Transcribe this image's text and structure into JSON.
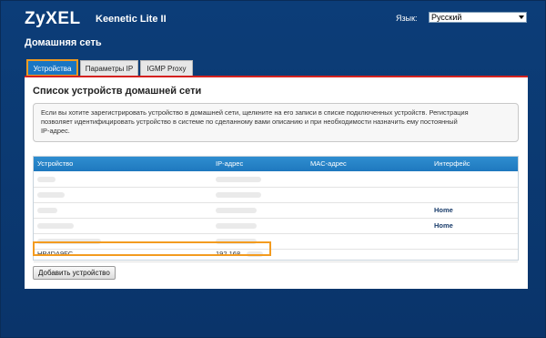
{
  "header": {
    "logo": "ZyXEL",
    "model": "Keenetic Lite II",
    "language_label": "Язык:",
    "language_value": "Русский"
  },
  "page_title": "Домашняя сеть",
  "tabs": [
    {
      "label": "Устройства",
      "active": true
    },
    {
      "label": "Параметры IP",
      "active": false
    },
    {
      "label": "IGMP Proxy",
      "active": false
    }
  ],
  "panel": {
    "title": "Список устройств домашней сети",
    "info_lines": [
      "Если вы хотите зарегистрировать устройство в домашней сети, щелкните на его записи в списке подключенных устройств. Регистрация",
      "позволяет идентифицировать устройство в системе по сделанному вами описанию и при необходимости назначить ему постоянный",
      "IP-адрес."
    ]
  },
  "table": {
    "columns": [
      "Устройство",
      "IP-адрес",
      "MAC-адрес",
      "Интерфейс"
    ],
    "rows": [
      {
        "device": "",
        "ip": "",
        "mac": "",
        "iface": ""
      },
      {
        "device": "",
        "ip": "",
        "mac": "",
        "iface": ""
      },
      {
        "device": "",
        "ip": "",
        "mac": "",
        "iface": "Home"
      },
      {
        "device": "",
        "ip": "",
        "mac": "",
        "iface": "Home"
      },
      {
        "device": "",
        "ip": "",
        "mac": "",
        "iface": ""
      },
      {
        "device": "HP4DA9FC",
        "ip": "192.168.",
        "mac": "",
        "iface": ""
      }
    ]
  },
  "add_button": "Добавить устройство",
  "colors": {
    "background": "#0b3a73",
    "tab_active": "#1a76c3",
    "highlight": "#f39b1f",
    "panel_top": "#d3211f",
    "table_header": "#1e78be"
  }
}
